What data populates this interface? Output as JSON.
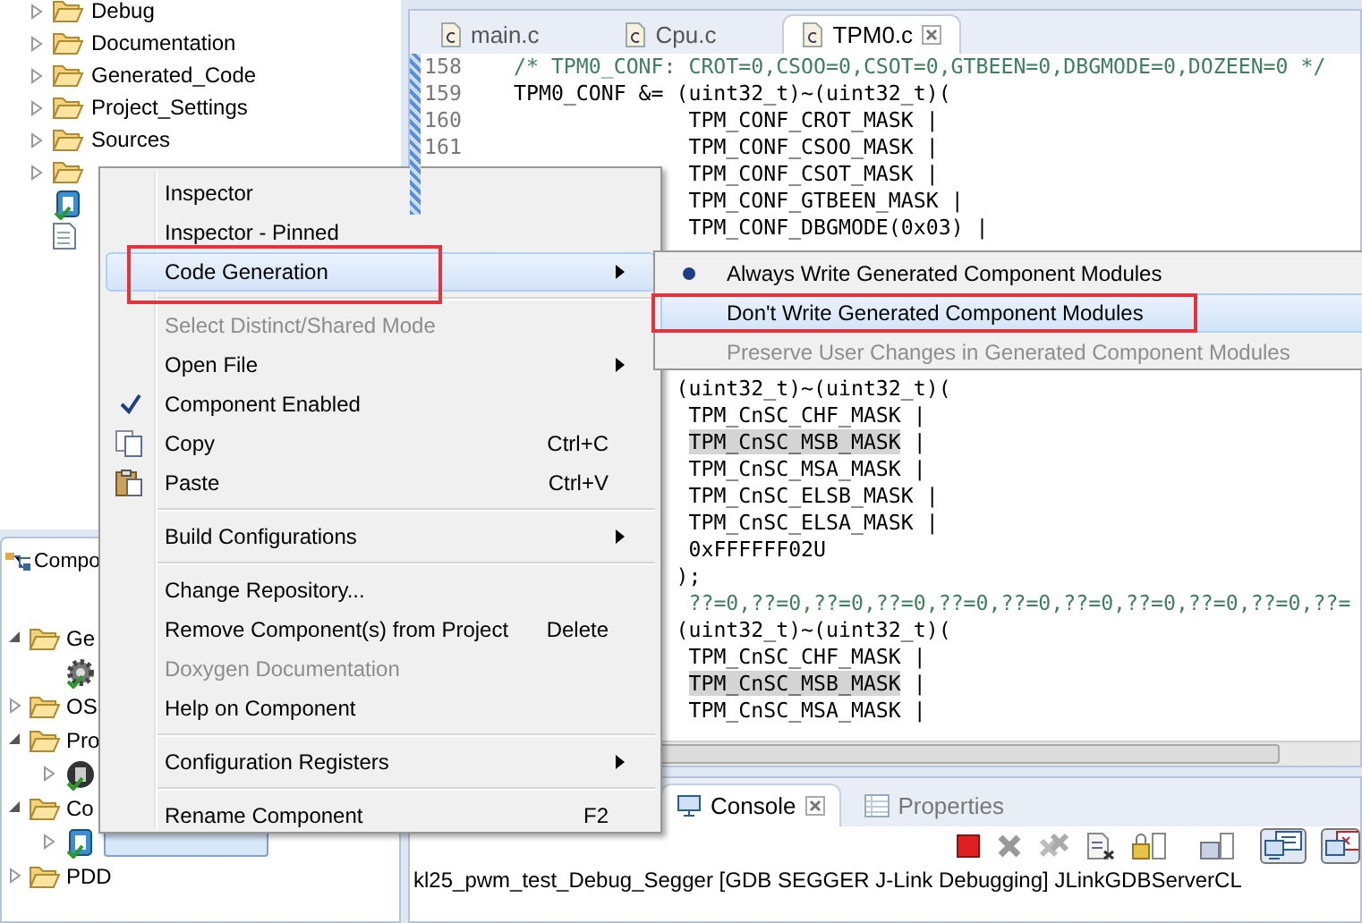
{
  "project_tree": [
    {
      "kind": "folder",
      "label": "Debug",
      "expanded": false
    },
    {
      "kind": "folder",
      "label": "Documentation",
      "expanded": false
    },
    {
      "kind": "folder",
      "label": "Generated_Code",
      "expanded": false
    },
    {
      "kind": "folder",
      "label": "Project_Settings",
      "expanded": false
    },
    {
      "kind": "folder",
      "label": "Sources",
      "expanded": false
    },
    {
      "kind": "folder",
      "expanded": false
    },
    {
      "kind": "component"
    },
    {
      "kind": "file"
    }
  ],
  "editor": {
    "tabs": [
      {
        "label": "main.c",
        "selected": false
      },
      {
        "label": "Cpu.c",
        "selected": false
      },
      {
        "label": "TPM0.c",
        "selected": true
      }
    ],
    "upper_lines": [
      {
        "number": "158",
        "kind": "comment",
        "text": "/* TPM0_CONF: CROT=0,CSOO=0,CSOT=0,GTBEEN=0,DBGMODE=0,DOZEEN=0 */"
      },
      {
        "number": "159",
        "kind": "code",
        "text": "TPM0_CONF &= (uint32_t)~(uint32_t)("
      },
      {
        "number": "160",
        "kind": "code",
        "text": "              TPM_CONF_CROT_MASK |"
      },
      {
        "number": "161",
        "kind": "code",
        "text": "              TPM_CONF_CSOO_MASK |"
      },
      {
        "kind": "code",
        "text": "              TPM_CONF_CSOT_MASK |"
      },
      {
        "kind": "code",
        "text": "              TPM_CONF_GTBEEN_MASK |"
      },
      {
        "kind": "code",
        "text": "              TPM_CONF_DBGMODE(0x03) |"
      }
    ],
    "lower_lines": [
      {
        "kind": "code",
        "text": "             (uint32_t)~(uint32_t)("
      },
      {
        "kind": "code",
        "text": "              TPM_CnSC_CHF_MASK |"
      },
      {
        "kind": "code",
        "text": "              TPM_CnSC_MSB_MASK",
        "suffix": " |",
        "highlighted": true
      },
      {
        "kind": "code",
        "text": "              TPM_CnSC_MSA_MASK |"
      },
      {
        "kind": "code",
        "text": "              TPM_CnSC_ELSB_MASK |"
      },
      {
        "kind": "code",
        "text": "              TPM_CnSC_ELSA_MASK |"
      },
      {
        "kind": "code",
        "text": "              0xFFFFFF02U"
      },
      {
        "kind": "code",
        "text": "             );"
      },
      {
        "kind": "comment",
        "text": "              ??=0,??=0,??=0,??=0,??=0,??=0,??=0,??=0,??=0,??=0,??="
      },
      {
        "kind": "code",
        "text": "             (uint32_t)~(uint32_t)("
      },
      {
        "kind": "code",
        "text": "              TPM_CnSC_CHF_MASK |"
      },
      {
        "kind": "code",
        "text": "              TPM_CnSC_MSB_MASK",
        "suffix": " |",
        "highlighted": true
      },
      {
        "kind": "code",
        "text": "              TPM_CnSC_MSA_MASK |"
      }
    ]
  },
  "components_panel": {
    "title": "Compo",
    "items": [
      {
        "kind": "folder",
        "label": "Ge",
        "expanded": true,
        "children": [
          {
            "kind": "gear"
          }
        ]
      },
      {
        "kind": "folder",
        "label": "OS",
        "expanded": false
      },
      {
        "kind": "folder",
        "label": "Pro",
        "expanded": true,
        "children": [
          {
            "kind": "cpu",
            "expanded": false
          }
        ]
      },
      {
        "kind": "folder",
        "label": "Co",
        "expanded": true,
        "children": [
          {
            "kind": "component",
            "expanded": false,
            "selected": true
          }
        ]
      },
      {
        "kind": "folder",
        "label": "PDD",
        "expanded": false
      }
    ]
  },
  "console": {
    "tabs": [
      {
        "label": "Console",
        "selected": true
      },
      {
        "label": "Properties",
        "selected": false
      }
    ],
    "output": "kl25_pwm_test_Debug_Segger [GDB SEGGER J-Link Debugging] JLinkGDBServerCL"
  },
  "context_menu": [
    {
      "kind": "item",
      "label": "Inspector",
      "submenu": false,
      "disabled": false,
      "selected": false
    },
    {
      "kind": "item",
      "label": "Inspector - Pinned",
      "submenu": false,
      "disabled": false,
      "selected": false
    },
    {
      "kind": "item",
      "label": "Code Generation",
      "submenu": true,
      "disabled": false,
      "selected": true,
      "framed": true
    },
    {
      "kind": "separator"
    },
    {
      "kind": "item",
      "label": "Select Distinct/Shared Mode",
      "submenu": false,
      "disabled": true,
      "selected": false
    },
    {
      "kind": "item",
      "label": "Open File",
      "submenu": true,
      "disabled": false,
      "selected": false
    },
    {
      "kind": "check",
      "label": "Component Enabled",
      "checked": true,
      "submenu": false,
      "disabled": false,
      "selected": false
    },
    {
      "kind": "copy",
      "label": "Copy",
      "shortcut": "Ctrl+C",
      "submenu": false,
      "disabled": false,
      "selected": false
    },
    {
      "kind": "paste",
      "label": "Paste",
      "shortcut": "Ctrl+V",
      "submenu": false,
      "disabled": false,
      "selected": false
    },
    {
      "kind": "separator"
    },
    {
      "kind": "item",
      "label": "Build Configurations",
      "submenu": true,
      "disabled": false,
      "selected": false
    },
    {
      "kind": "separator"
    },
    {
      "kind": "item",
      "label": "Change Repository...",
      "submenu": false,
      "disabled": false,
      "selected": false
    },
    {
      "kind": "item",
      "label": "Remove Component(s) from Project",
      "shortcut": "Delete",
      "submenu": false,
      "disabled": false,
      "selected": false
    },
    {
      "kind": "item",
      "label": "Doxygen Documentation",
      "submenu": false,
      "disabled": true,
      "selected": false
    },
    {
      "kind": "item",
      "label": "Help on Component",
      "submenu": false,
      "disabled": false,
      "selected": false
    },
    {
      "kind": "separator"
    },
    {
      "kind": "item",
      "label": "Configuration Registers",
      "submenu": true,
      "disabled": false,
      "selected": false
    },
    {
      "kind": "separator"
    },
    {
      "kind": "item",
      "label": "Rename Component",
      "shortcut": "F2",
      "submenu": false,
      "disabled": false,
      "selected": false
    }
  ],
  "submenu": [
    {
      "label": "Always Write Generated Component Modules",
      "checked": true,
      "disabled": false,
      "selected": false
    },
    {
      "label": "Don't Write Generated Component Modules",
      "checked": false,
      "disabled": false,
      "selected": true,
      "framed": true
    },
    {
      "label": "Preserve User Changes in Generated Component Modules",
      "checked": false,
      "disabled": true,
      "selected": false
    }
  ]
}
